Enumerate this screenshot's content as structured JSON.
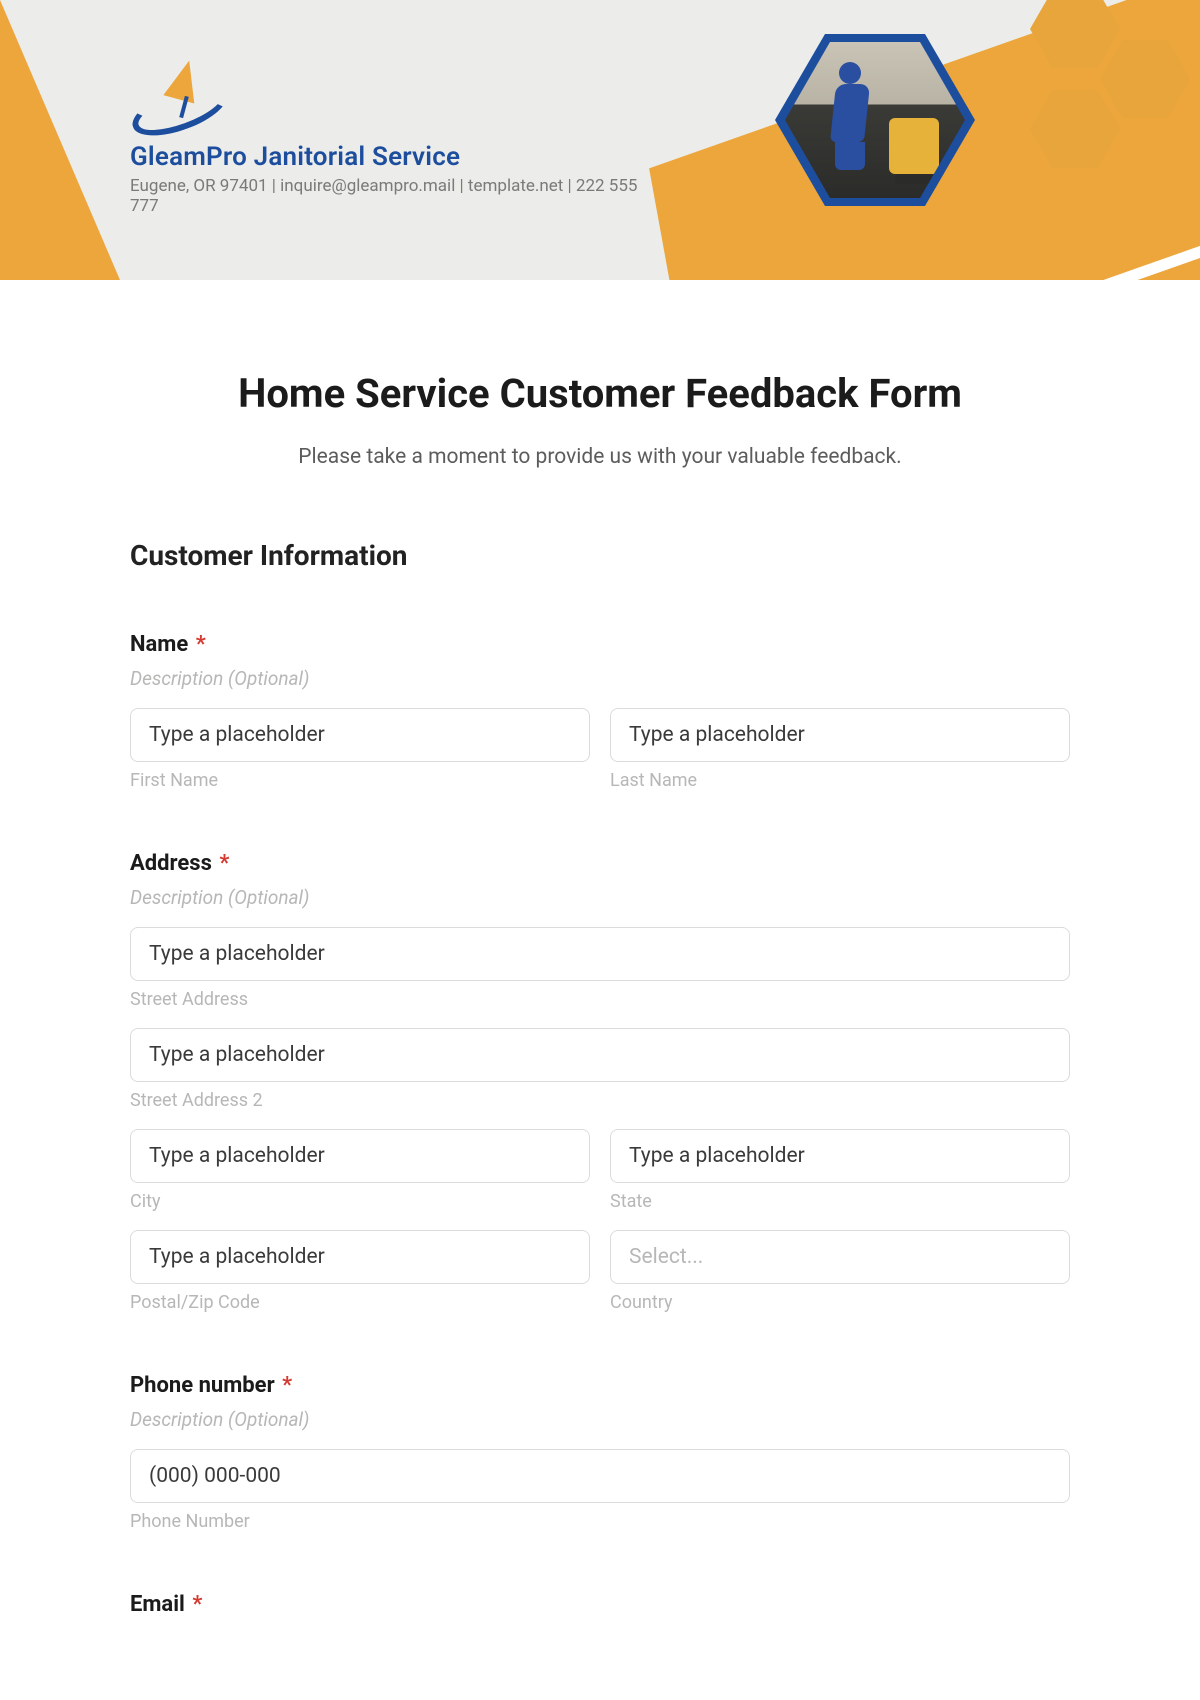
{
  "header": {
    "brand_name": "GleamPro Janitorial Service",
    "brand_sub": "Eugene, OR 97401 | inquire@gleampro.mail | template.net | 222 555 777",
    "colors": {
      "accent_orange": "#eca63b",
      "accent_blue": "#1d4e9e",
      "bg": "#ececea"
    }
  },
  "form": {
    "title": "Home Service Customer Feedback Form",
    "subtitle": "Please take a moment to provide us with your valuable feedback.",
    "section_customer_info": "Customer Information",
    "required_mark": "*",
    "name": {
      "label": "Name",
      "description": "Description (Optional)",
      "first_placeholder": "Type a placeholder",
      "last_placeholder": "Type a placeholder",
      "first_sub": "First Name",
      "last_sub": "Last Name"
    },
    "address": {
      "label": "Address",
      "description": "Description (Optional)",
      "street_placeholder": "Type a placeholder",
      "street_sub": "Street Address",
      "street2_placeholder": "Type a placeholder",
      "street2_sub": "Street Address 2",
      "city_placeholder": "Type a placeholder",
      "city_sub": "City",
      "state_placeholder": "Type a placeholder",
      "state_sub": "State",
      "zip_placeholder": "Type a placeholder",
      "zip_sub": "Postal/Zip Code",
      "country_placeholder": "Select...",
      "country_sub": "Country"
    },
    "phone": {
      "label": "Phone number",
      "description": "Description (Optional)",
      "placeholder": "(000) 000-000",
      "sub": "Phone Number"
    },
    "email": {
      "label": "Email"
    }
  }
}
